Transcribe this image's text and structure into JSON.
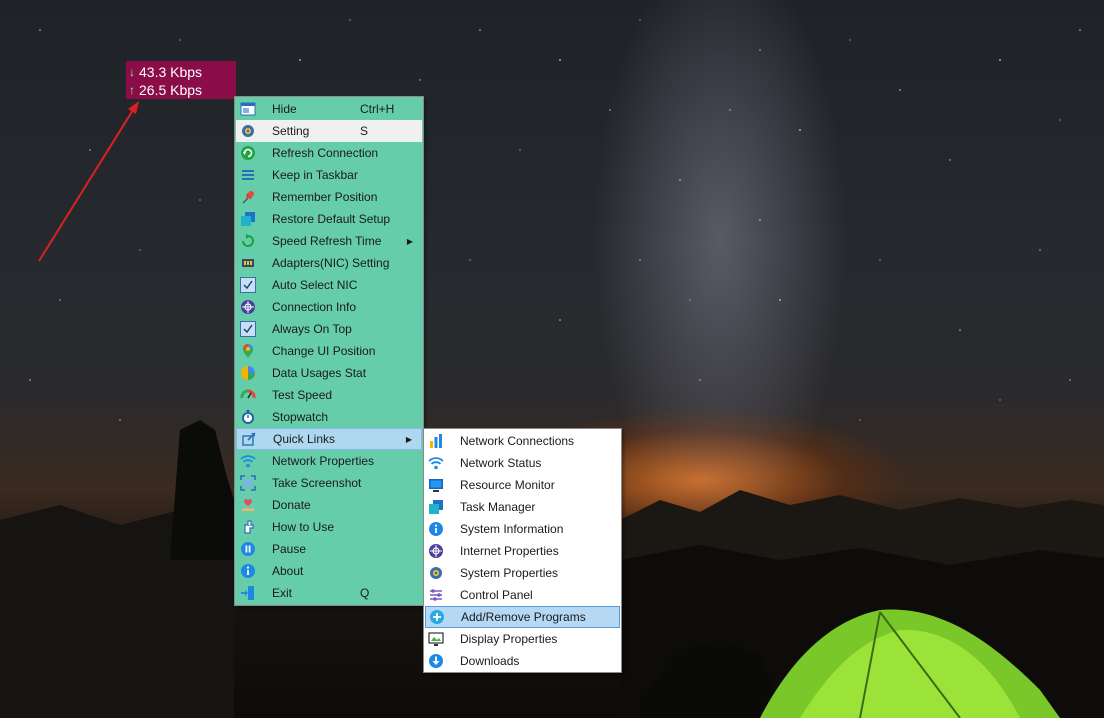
{
  "speed_widget": {
    "download": "43.3 Kbps",
    "upload": "26.5 Kbps",
    "download_arrow": "↓",
    "upload_arrow": "↑",
    "background": "#8a0d4a"
  },
  "main_menu": {
    "background": "#66cdaa",
    "items": [
      {
        "label": "Hide",
        "shortcut": "Ctrl+H",
        "icon": "window-icon"
      },
      {
        "label": "Setting",
        "shortcut": "S",
        "icon": "gear-icon"
      },
      {
        "label": "Refresh Connection",
        "shortcut": "",
        "icon": "refresh-icon"
      },
      {
        "label": "Keep in Taskbar",
        "shortcut": "",
        "icon": "list-icon"
      },
      {
        "label": "Remember Position",
        "shortcut": "",
        "icon": "pin-icon"
      },
      {
        "label": "Restore Default Setup",
        "shortcut": "",
        "icon": "copy-icon"
      },
      {
        "label": "Speed Refresh Time",
        "shortcut": "",
        "icon": "refresh-outline-icon",
        "submenu_arrow": "▶"
      },
      {
        "label": "Adapters(NIC) Setting",
        "shortcut": "",
        "icon": "network-adapter-icon"
      },
      {
        "label": "Auto Select NIC",
        "shortcut": "",
        "icon": "checkmark-icon",
        "checked": true
      },
      {
        "label": "Connection Info",
        "shortcut": "",
        "icon": "network-globe-icon"
      },
      {
        "label": "Always On Top",
        "shortcut": "",
        "icon": "checkmark-icon",
        "checked": true
      },
      {
        "label": "Change UI Position",
        "shortcut": "",
        "icon": "map-pin-icon"
      },
      {
        "label": "Data Usages Stat",
        "shortcut": "",
        "icon": "pie-chart-icon"
      },
      {
        "label": "Test Speed",
        "shortcut": "",
        "icon": "speedometer-icon"
      },
      {
        "label": "Stopwatch",
        "shortcut": "",
        "icon": "stopwatch-icon"
      },
      {
        "label": "Quick Links",
        "shortcut": "",
        "icon": "share-icon",
        "submenu_arrow": "▶"
      },
      {
        "label": "Network Properties",
        "shortcut": "",
        "icon": "wifi-icon"
      },
      {
        "label": "Take Screenshot",
        "shortcut": "",
        "icon": "screenshot-icon"
      },
      {
        "label": "Donate",
        "shortcut": "",
        "icon": "heart-hand-icon"
      },
      {
        "label": "How to Use",
        "shortcut": "",
        "icon": "hand-pointer-icon"
      },
      {
        "label": "Pause",
        "shortcut": "",
        "icon": "pause-icon"
      },
      {
        "label": "About",
        "shortcut": "",
        "icon": "info-icon"
      },
      {
        "label": "Exit",
        "shortcut": "Q",
        "icon": "exit-icon"
      }
    ]
  },
  "quick_links_menu": {
    "items": [
      {
        "label": "Network Connections",
        "icon": "bar-chart-icon"
      },
      {
        "label": "Network Status",
        "icon": "wifi-icon"
      },
      {
        "label": "Resource Monitor",
        "icon": "monitor-icon"
      },
      {
        "label": "Task Manager",
        "icon": "copy-icon"
      },
      {
        "label": "System Information",
        "icon": "info-icon"
      },
      {
        "label": "Internet Properties",
        "icon": "network-globe-icon"
      },
      {
        "label": "System Properties",
        "icon": "gear-icon"
      },
      {
        "label": "Control Panel",
        "icon": "sliders-icon"
      },
      {
        "label": "Add/Remove Programs",
        "icon": "add-circle-icon"
      },
      {
        "label": "Display Properties",
        "icon": "display-icon"
      },
      {
        "label": "Downloads",
        "icon": "download-icon"
      }
    ]
  },
  "colors": {
    "menu_green": "#66cdaa",
    "highlight_blue": "#add8f0",
    "pointer_arrow": "#e02020"
  }
}
